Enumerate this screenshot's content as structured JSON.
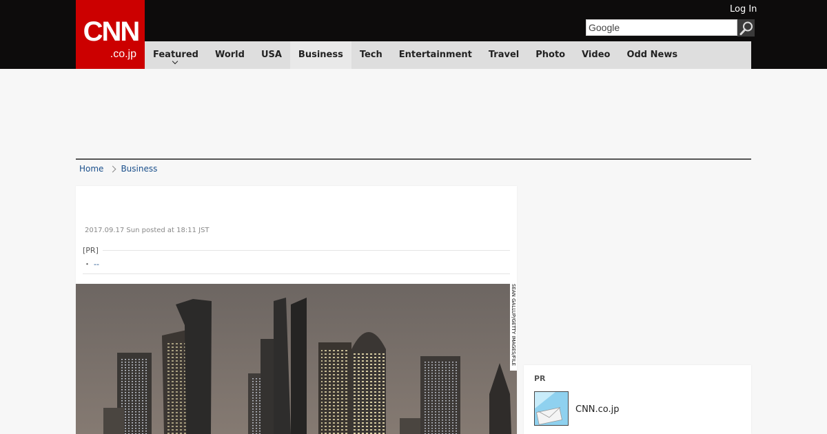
{
  "header": {
    "logo_main": "CNN",
    "logo_sub": ".co.jp",
    "login_label": "Log In",
    "search_placeholder": "Google",
    "nav": [
      {
        "label": "Featured"
      },
      {
        "label": "World"
      },
      {
        "label": "USA"
      },
      {
        "label": "Business"
      },
      {
        "label": "Tech"
      },
      {
        "label": "Entertainment"
      },
      {
        "label": "Travel"
      },
      {
        "label": "Photo"
      },
      {
        "label": "Video"
      },
      {
        "label": "Odd News"
      }
    ],
    "active_nav": "Business"
  },
  "breadcrumb": {
    "home": "Home",
    "current": "Business"
  },
  "article": {
    "posted": "2017.09.17 Sun posted at 18:11 JST",
    "pr_label": "[PR]",
    "pr_bullet": "・",
    "pr_link": "--",
    "photo_credit": "SEAN GALLUP/GETTY IMAGES/FILE"
  },
  "sidebar": {
    "pr_title": "PR",
    "pr_item_name": "CNN.co.jp"
  },
  "colors": {
    "brand_red": "#cc0000",
    "topbar": "#0d0c0c",
    "nav_bg": "#dedede",
    "link": "#1a4f8b"
  }
}
